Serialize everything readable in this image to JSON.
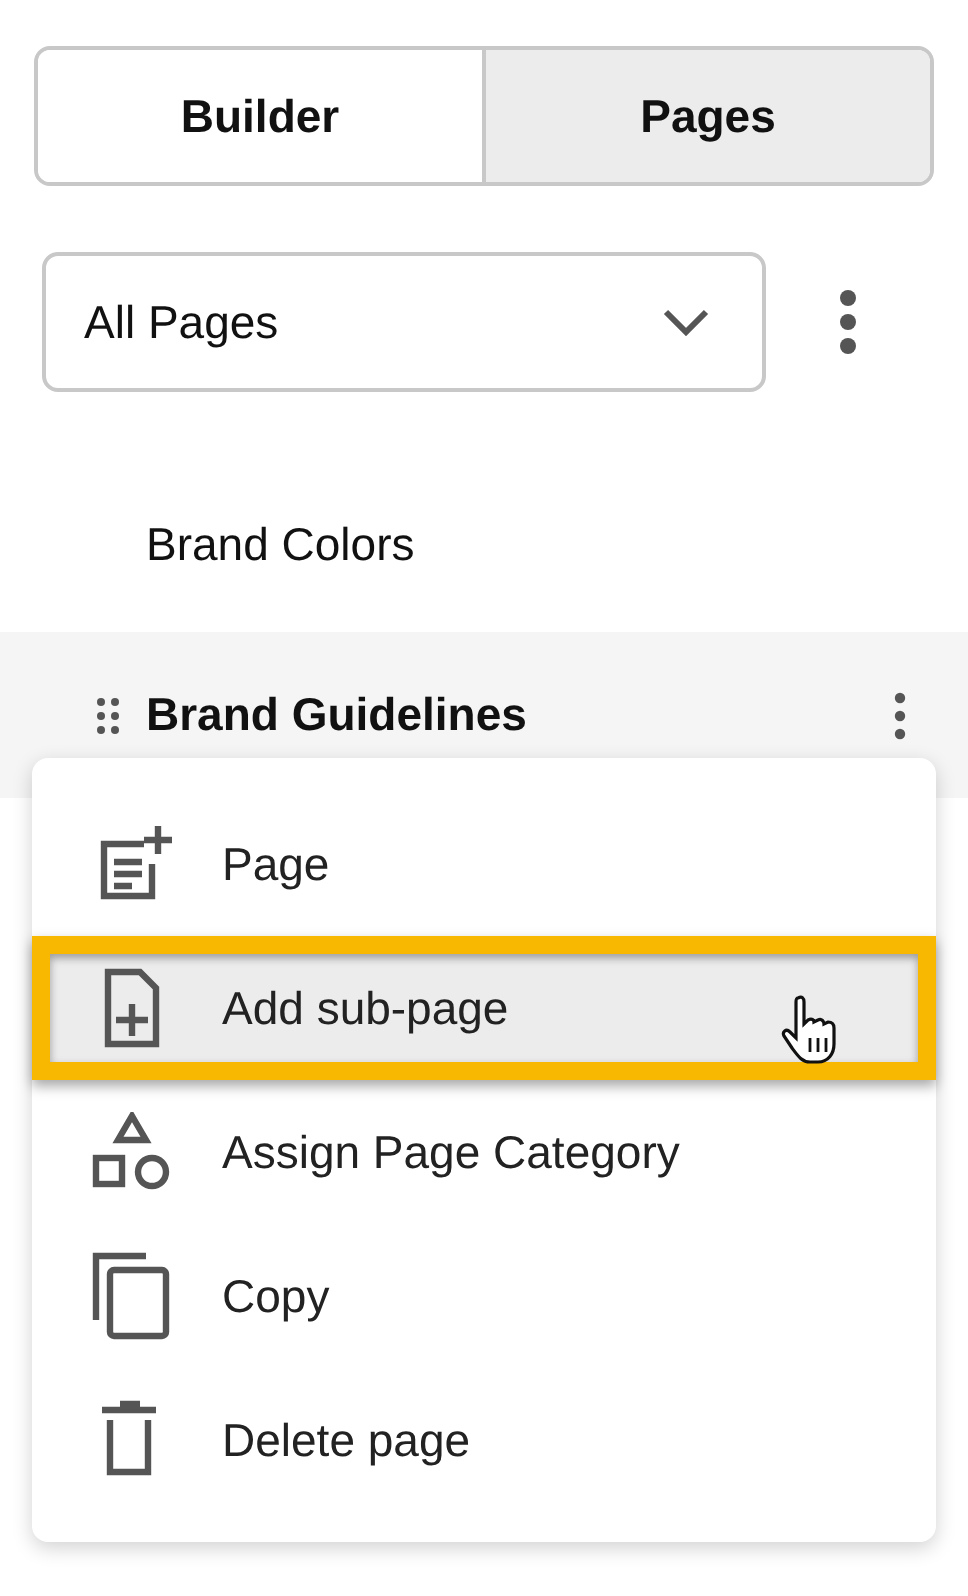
{
  "tabs": [
    {
      "label": "Builder",
      "selected": false
    },
    {
      "label": "Pages",
      "selected": true
    }
  ],
  "filter": {
    "value": "All Pages"
  },
  "pages": [
    {
      "label": "Brand Colors",
      "selected": false
    },
    {
      "label": "Brand Guidelines",
      "selected": true
    }
  ],
  "context_menu": {
    "items": [
      {
        "label": "Page",
        "selected": false
      },
      {
        "label": "Add sub-page",
        "selected": true
      },
      {
        "label": "Assign Page Category",
        "selected": false
      },
      {
        "label": "Copy",
        "selected": false
      },
      {
        "label": "Delete page",
        "selected": false
      }
    ]
  }
}
